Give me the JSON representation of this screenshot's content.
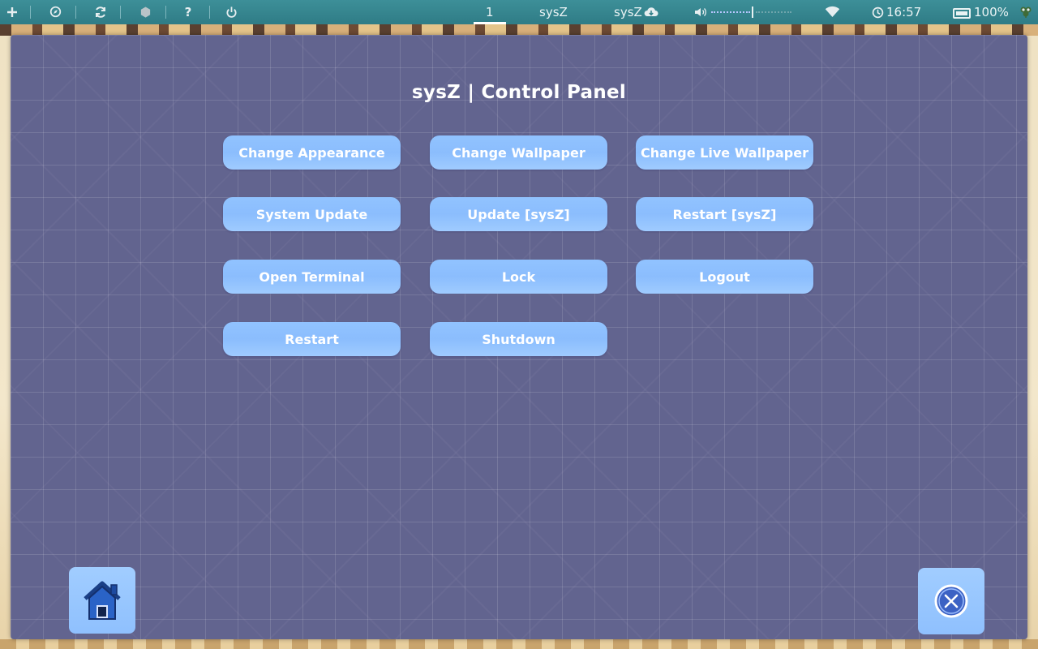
{
  "topbar": {
    "add_icon": "plus-icon",
    "compass_icon": "compass-icon",
    "refresh_icon": "refresh-icon",
    "hexagon_icon": "hexagon-icon",
    "help_label": "?",
    "power_icon": "power-icon",
    "workspace_number": "1",
    "workspace_name": "sysZ",
    "app_name": "sysZ",
    "cloud_icon": "cloud-download-icon",
    "volume_icon": "volume-icon",
    "wifi_icon": "wifi-icon",
    "clock_icon": "clock-icon",
    "time": "16:57",
    "battery_icon": "battery-icon",
    "battery_level": "100%",
    "tray_icon": "leaf-tray-icon"
  },
  "panel": {
    "title": "sysZ | Control Panel",
    "buttons": [
      "Change Appearance",
      "Change Wallpaper",
      "Change Live Wallpaper",
      "System Update",
      "Update [sysZ]",
      "Restart [sysZ]",
      "Open Terminal",
      "Lock",
      "Logout",
      "Restart",
      "Shutdown"
    ],
    "home_icon": "home-icon",
    "close_icon": "close-circle-icon"
  },
  "colors": {
    "topbar": "#2f7c86",
    "window_bg": "#62648f",
    "button_bg": "#91c3ff",
    "button_text": "#ffffff"
  }
}
